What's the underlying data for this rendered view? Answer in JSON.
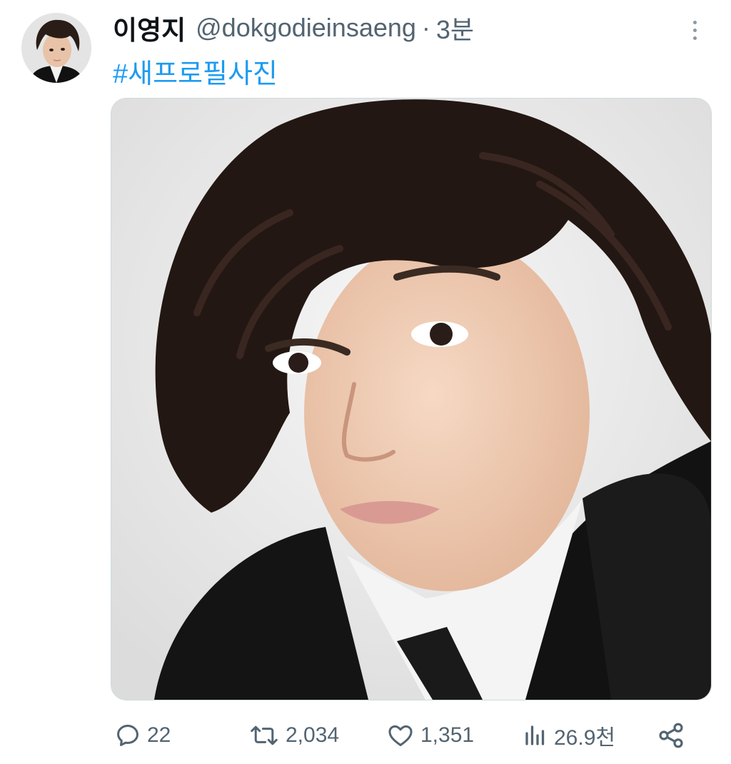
{
  "tweet": {
    "author_name": "이영지",
    "author_handle": "@dokgodieinsaeng",
    "separator": "·",
    "time": "3분",
    "hashtag": "#새프로필사진"
  },
  "actions": {
    "replies": "22",
    "retweets": "2,034",
    "likes": "1,351",
    "views": "26.9천"
  },
  "icons": {
    "reply": "speech-bubble-icon",
    "retweet": "retweet-arrows-icon",
    "like": "heart-icon",
    "views": "bar-chart-icon",
    "share": "share-nodes-icon",
    "more": "vertical-dots-icon"
  },
  "colors": {
    "hashtag": "#1d9bf0",
    "secondary_text": "#536471",
    "primary_text": "#0f1419"
  }
}
